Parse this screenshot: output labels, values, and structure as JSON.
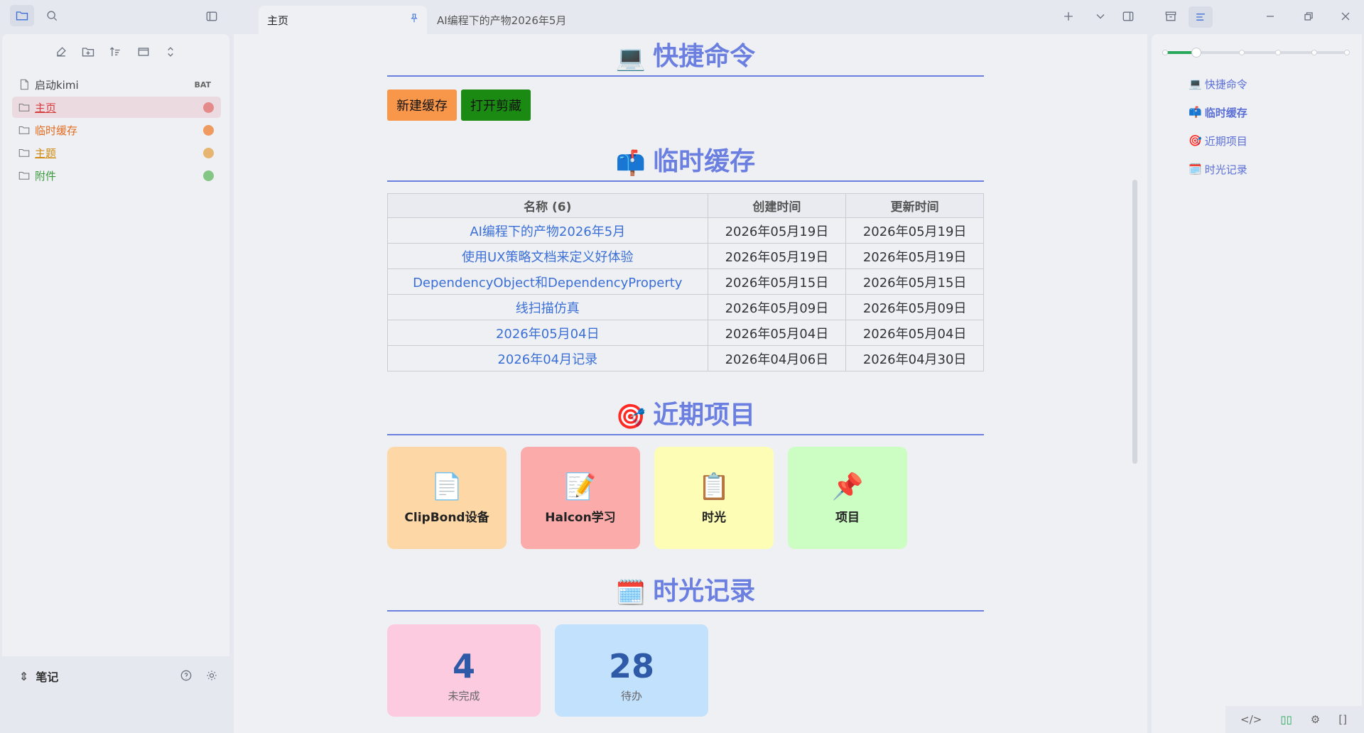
{
  "titlebar": {
    "tabs": [
      {
        "label": "主页",
        "active": true
      },
      {
        "label": "AI编程下的产物2026年5月",
        "active": false
      }
    ],
    "icons": [
      "folder-icon",
      "search-icon",
      "sidebar-toggle-icon",
      "plus-icon",
      "chevron-down-icon",
      "right-sidebar-toggle-icon",
      "archive-icon",
      "outline-icon",
      "minimize-icon",
      "restore-icon",
      "close-icon"
    ]
  },
  "sidebar": {
    "toolbar_icons": [
      "new-note-icon",
      "new-folder-icon",
      "sort-icon",
      "collapse-view-icon",
      "expand-collapse-icon"
    ],
    "items": [
      {
        "label": "启动kimi",
        "type": "file",
        "ext": "BAT",
        "color": "#444444"
      },
      {
        "label": "主页",
        "type": "folder",
        "selected": true,
        "color": "#d63a3a",
        "dot": "#e58a8a"
      },
      {
        "label": "临时缓存",
        "type": "folder",
        "color": "#e46b1f",
        "dot": "#ef9a5e"
      },
      {
        "label": "主题",
        "type": "folder",
        "color": "#d08a12",
        "dot": "#e6b670"
      },
      {
        "label": "附件",
        "type": "folder",
        "color": "#3e9a3e",
        "dot": "#84c684"
      }
    ],
    "footer": {
      "vault": "笔记"
    }
  },
  "main": {
    "sections": {
      "commands": {
        "title": "快捷命令",
        "emoji": "💻"
      },
      "cache": {
        "title": "临时缓存",
        "emoji": "📫"
      },
      "projects": {
        "title": "近期项目",
        "emoji": "🎯"
      },
      "time": {
        "title": "时光记录",
        "emoji": "🗓️"
      }
    },
    "buttons": [
      {
        "label": "新建缓存",
        "bg": "#f8964a"
      },
      {
        "label": "打开剪藏",
        "bg": "#1a8a12"
      }
    ],
    "table": {
      "headers": [
        "名称 (6)",
        "创建时间",
        "更新时间"
      ],
      "rows": [
        [
          "AI编程下的产物2026年5月",
          "2026年05月19日",
          "2026年05月19日"
        ],
        [
          "使用UX策略文档来定义好体验",
          "2026年05月19日",
          "2026年05月19日"
        ],
        [
          "DependencyObject和DependencyProperty",
          "2026年05月15日",
          "2026年05月15日"
        ],
        [
          "线扫描仿真",
          "2026年05月09日",
          "2026年05月09日"
        ],
        [
          "2026年05月04日",
          "2026年05月04日",
          "2026年05月04日"
        ],
        [
          "2026年04月记录",
          "2026年04月06日",
          "2026年04月30日"
        ]
      ]
    },
    "cards": [
      {
        "label": "ClipBond设备",
        "emoji": "📄",
        "bg": "#fdd8a6"
      },
      {
        "label": "Halcon学习",
        "emoji": "📝",
        "bg": "#fcabab"
      },
      {
        "label": "时光",
        "emoji": "📋",
        "bg": "#fdfdb6"
      },
      {
        "label": "项目",
        "emoji": "📌",
        "bg": "#ccfdc3"
      }
    ],
    "stats": [
      {
        "value": "4",
        "label": "未完成",
        "bg": "#fdcbe0"
      },
      {
        "value": "28",
        "label": "待办",
        "bg": "#c2e1fd"
      }
    ]
  },
  "outline": {
    "items": [
      {
        "label": "快捷命令",
        "emoji": "💻",
        "current": false
      },
      {
        "label": "临时缓存",
        "emoji": "📫",
        "current": true
      },
      {
        "label": "近期项目",
        "emoji": "🎯",
        "current": false
      },
      {
        "label": "时光记录",
        "emoji": "🗓️",
        "current": false
      }
    ],
    "scroll_progress": 0.18,
    "footer_icons": [
      "code-icon",
      "reading-icon",
      "settings-sliders-icon",
      "split-icon"
    ]
  }
}
